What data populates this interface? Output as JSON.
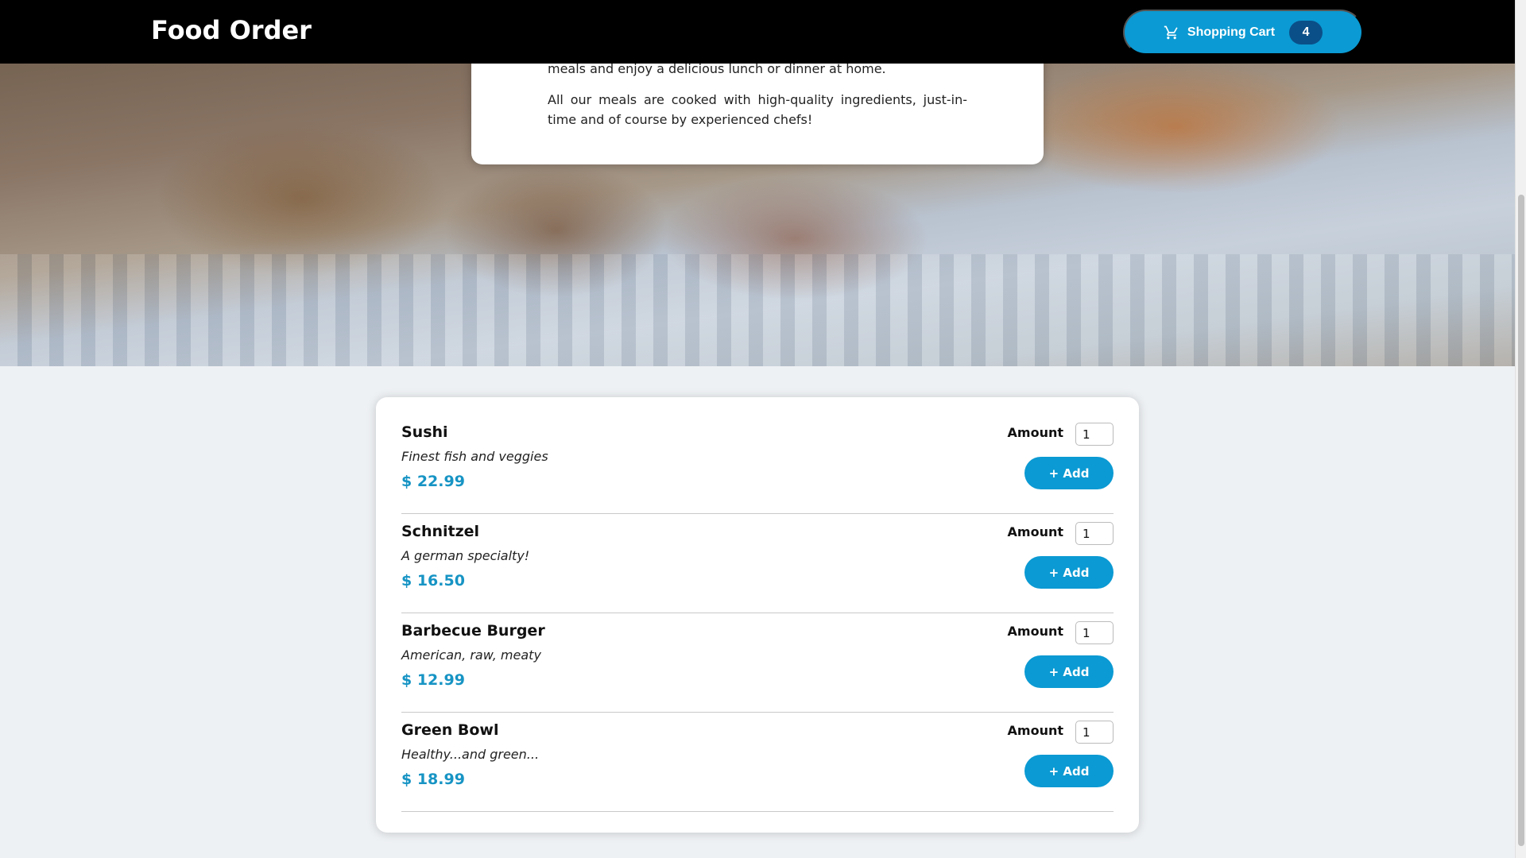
{
  "header": {
    "title": "Food Order",
    "cart_label": "Shopping Cart",
    "cart_count": "4"
  },
  "summary": {
    "paragraph_1": "meals and enjoy a delicious lunch or dinner at home.",
    "paragraph_2": "All our meals are cooked with high-quality ingredients, just-in-time and of course by experienced chefs!"
  },
  "meals": [
    {
      "name": "Sushi",
      "description": "Finest fish and veggies",
      "price": "$ 22.99",
      "amount_label": "Amount",
      "amount_value": "1",
      "add_label": "+ Add"
    },
    {
      "name": "Schnitzel",
      "description": "A german specialty!",
      "price": "$ 16.50",
      "amount_label": "Amount",
      "amount_value": "1",
      "add_label": "+ Add"
    },
    {
      "name": "Barbecue Burger",
      "description": "American, raw, meaty",
      "price": "$ 12.99",
      "amount_label": "Amount",
      "amount_value": "1",
      "add_label": "+ Add"
    },
    {
      "name": "Green Bowl",
      "description": "Healthy...and green...",
      "price": "$ 18.99",
      "amount_label": "Amount",
      "amount_value": "1",
      "add_label": "+ Add"
    }
  ],
  "colors": {
    "accent": "#0b9ad3",
    "badge": "#0b4f88",
    "price": "#1794c4",
    "header_bg": "#000000"
  },
  "icons": {
    "cart": "shopping-cart-icon"
  }
}
